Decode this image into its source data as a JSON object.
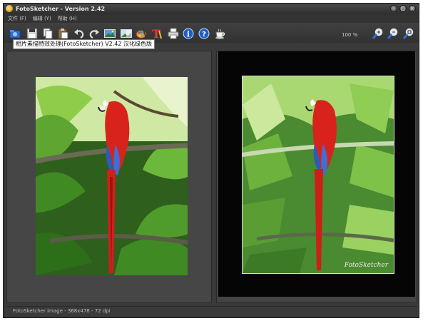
{
  "window": {
    "title": "FotoSketcher - Version 2.42"
  },
  "menu": {
    "items": [
      "文件 (F)",
      "编辑 (Y)",
      "帮助 (H)"
    ]
  },
  "toolbar": {
    "icons": [
      "open-folder",
      "save",
      "copy",
      "paste",
      "undo",
      "redo",
      "landscape-image",
      "image-compare",
      "palette",
      "text-tool",
      "print",
      "info",
      "help",
      "coffee"
    ],
    "zoom_label": "100 %",
    "zoom_buttons": [
      "zoom-in",
      "zoom-out",
      "zoom-fit"
    ]
  },
  "tooltip": {
    "text": "相片素描特效处理(FotoSketcher) V2.42 汉化绿色版"
  },
  "preview": {
    "signature": "FotoSketcher"
  },
  "status": {
    "text": "FotoSketcher image - 368x478 - 72 dpi"
  },
  "colors": {
    "window_bg": "#3a3a3a",
    "right_canvas": "#050505",
    "parrot_red": "#d8231d"
  }
}
